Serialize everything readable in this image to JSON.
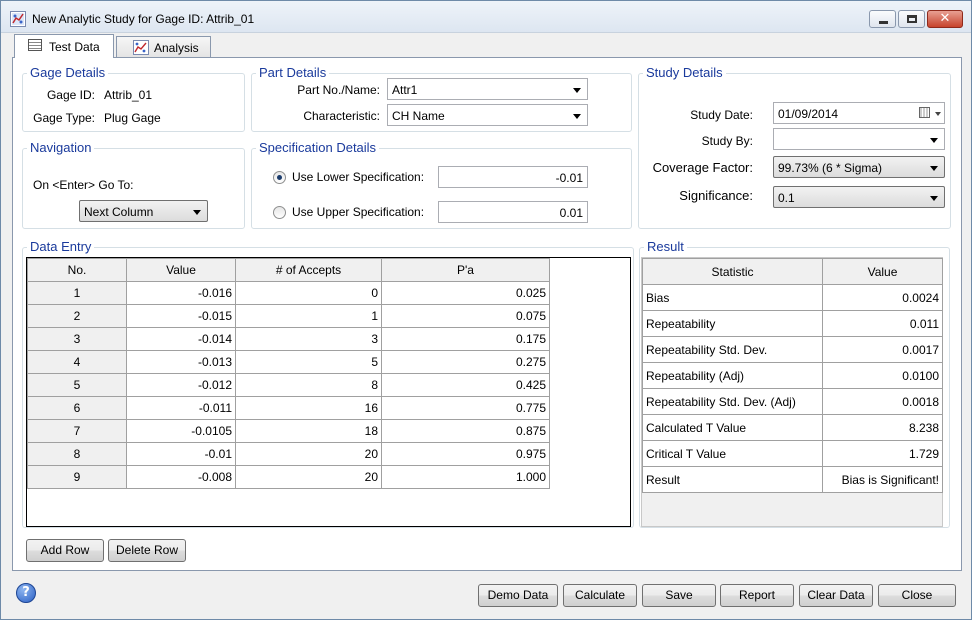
{
  "window": {
    "title": "New Analytic Study for Gage ID:  Attrib_01"
  },
  "tabs": [
    {
      "label": "Test Data"
    },
    {
      "label": "Analysis"
    }
  ],
  "gage_details": {
    "title": "Gage Details",
    "gage_id_label": "Gage ID:",
    "gage_id_value": "Attrib_01",
    "gage_type_label": "Gage Type:",
    "gage_type_value": "Plug Gage"
  },
  "part_details": {
    "title": "Part Details",
    "part_label": "Part No./Name:",
    "part_value": "Attr1",
    "char_label": "Characteristic:",
    "char_value": "CH Name"
  },
  "study_details": {
    "title": "Study Details",
    "date_label": "Study Date:",
    "date_value": "01/09/2014",
    "by_label": "Study By:",
    "by_value": "",
    "coverage_label": "Coverage Factor:",
    "coverage_value": "99.73% (6 * Sigma)",
    "significance_label": "Significance:",
    "significance_value": "0.1"
  },
  "navigation": {
    "title": "Navigation",
    "goto_label": "On <Enter> Go To:",
    "goto_value": "Next Column"
  },
  "spec_details": {
    "title": "Specification Details",
    "lower_label": "Use Lower Specification:",
    "lower_value": "-0.01",
    "upper_label": "Use Upper Specification:",
    "upper_value": "0.01"
  },
  "data_entry": {
    "title": "Data Entry",
    "columns": [
      "No.",
      "Value",
      "# of Accepts",
      "P'a"
    ],
    "rows": [
      [
        "1",
        "-0.016",
        "0",
        "0.025"
      ],
      [
        "2",
        "-0.015",
        "1",
        "0.075"
      ],
      [
        "3",
        "-0.014",
        "3",
        "0.175"
      ],
      [
        "4",
        "-0.013",
        "5",
        "0.275"
      ],
      [
        "5",
        "-0.012",
        "8",
        "0.425"
      ],
      [
        "6",
        "-0.011",
        "16",
        "0.775"
      ],
      [
        "7",
        "-0.0105",
        "18",
        "0.875"
      ],
      [
        "8",
        "-0.01",
        "20",
        "0.975"
      ],
      [
        "9",
        "-0.008",
        "20",
        "1.000"
      ]
    ]
  },
  "result": {
    "title": "Result",
    "columns": [
      "Statistic",
      "Value"
    ],
    "rows": [
      [
        "Bias",
        "0.0024"
      ],
      [
        "Repeatability",
        "0.011"
      ],
      [
        "Repeatability Std. Dev.",
        "0.0017"
      ],
      [
        "Repeatability (Adj)",
        "0.0100"
      ],
      [
        "Repeatability Std. Dev. (Adj)",
        "0.0018"
      ],
      [
        "Calculated T Value",
        "8.238"
      ],
      [
        "Critical T Value",
        "1.729"
      ],
      [
        "Result",
        "Bias is Significant!"
      ]
    ]
  },
  "buttons": {
    "add_row": "Add Row",
    "delete_row": "Delete Row",
    "demo_data": "Demo Data",
    "calculate": "Calculate",
    "save": "Save",
    "report": "Report",
    "clear_data": "Clear Data",
    "close": "Close"
  }
}
